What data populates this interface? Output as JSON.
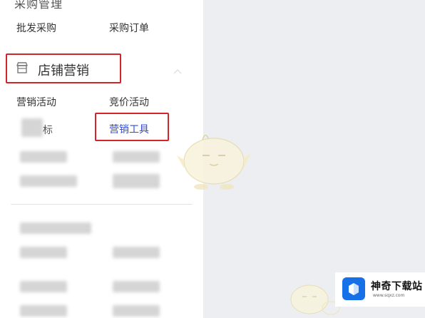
{
  "sidebar": {
    "top_section": {
      "label": "采购管理"
    },
    "purchase_items": [
      {
        "label": "批发采购"
      },
      {
        "label": "采购订单"
      }
    ],
    "store_marketing": {
      "icon": "shop-icon",
      "label": "店铺营销"
    },
    "marketing_items": [
      {
        "label": "营销活动"
      },
      {
        "label": "竞价活动"
      },
      {
        "label": "标"
      },
      {
        "label": "营销工具",
        "highlighted": true
      }
    ]
  },
  "watermark": {
    "title": "神奇下载站",
    "url": "www.sqxz.com"
  },
  "colors": {
    "highlight_box": "#d6232a",
    "active_link": "#2f4bd8",
    "watermark_logo": "#1670e8"
  }
}
